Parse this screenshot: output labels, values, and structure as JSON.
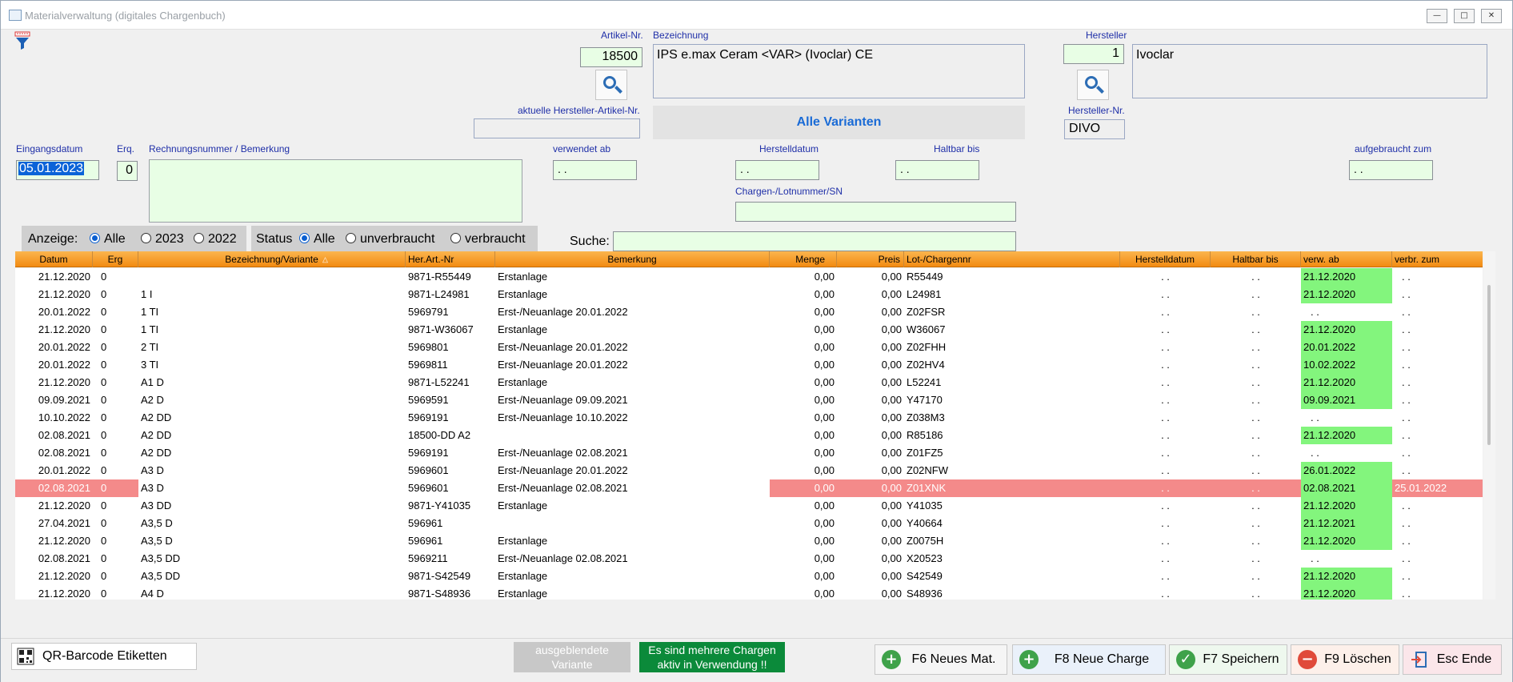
{
  "window": {
    "title": "Materialverwaltung  (digitales Chargenbuch)",
    "controls": {
      "minimize": "—",
      "maximize": "□",
      "close": "✕"
    }
  },
  "header": {
    "artikel_nr_label": "Artikel-Nr.",
    "artikel_nr_value": "18500",
    "bezeichnung_label": "Bezeichnung",
    "bezeichnung_value": "IPS e.max Ceram <VAR> (Ivoclar) CE",
    "hersteller_label": "Hersteller",
    "hersteller_value": "1",
    "hersteller_name_value": "Ivoclar",
    "akt_hersteller_artikel_label": "aktuelle Hersteller-Artikel-Nr.",
    "akt_hersteller_artikel_value": "",
    "variants_banner": "Alle Varianten",
    "hersteller_nr_label": "Hersteller-Nr.",
    "hersteller_nr_value": "DIVO"
  },
  "form": {
    "eingangsdatum_label": "Eingangsdatum",
    "eingangsdatum_value": "05.01.2023",
    "erq_label": "Erq.",
    "erq_value": "0",
    "rechnung_label": "Rechnungsnummer / Bemerkung",
    "rechnung_value": "",
    "verwendet_ab_label": "verwendet ab",
    "verwendet_ab_value": "  .  .",
    "herstelldatum_label": "Herstelldatum",
    "herstelldatum_value": "  .  .",
    "haltbar_bis_label": "Haltbar bis",
    "haltbar_bis_value": "  .  .",
    "aufgebraucht_label": "aufgebraucht zum",
    "aufgebraucht_value": "  .  .",
    "chargen_label": "Chargen-/Lotnummer/SN",
    "chargen_value": ""
  },
  "filter": {
    "anzeige_label": "Anzeige:",
    "anzeige_options": [
      "Alle",
      "2023",
      "2022"
    ],
    "anzeige_selected": "Alle",
    "status_label": "Status",
    "status_options": [
      "Alle",
      "unverbraucht",
      "verbraucht"
    ],
    "status_selected": "Alle",
    "suche_label": "Suche:",
    "suche_value": ""
  },
  "grid": {
    "columns": [
      "Datum",
      "Erg",
      "Bezeichnung/Variante",
      "Her.Art.-Nr",
      "Bemerkung",
      "Menge",
      "Preis",
      "Lot-/Chargennr",
      "Herstelldatum",
      "Haltbar bis",
      "verw. ab",
      "verbr. zum"
    ],
    "sort_indicator": "△",
    "rows": [
      [
        "21.12.2020",
        "0",
        "",
        "9871-R55449",
        "Erstanlage",
        "0,00",
        "0,00",
        "R55449",
        ". .",
        ". .",
        "21.12.2020",
        ". ."
      ],
      [
        "21.12.2020",
        "0",
        "1 I",
        "9871-L24981",
        "Erstanlage",
        "0,00",
        "0,00",
        "L24981",
        ". .",
        ". .",
        "21.12.2020",
        ". ."
      ],
      [
        "20.01.2022",
        "0",
        "1 TI",
        "5969791",
        "Erst-/Neuanlage 20.01.2022",
        "0,00",
        "0,00",
        "Z02FSR",
        ". .",
        ". .",
        ". .",
        ". ."
      ],
      [
        "21.12.2020",
        "0",
        "1 TI",
        "9871-W36067",
        "Erstanlage",
        "0,00",
        "0,00",
        "W36067",
        ". .",
        ". .",
        "21.12.2020",
        ". ."
      ],
      [
        "20.01.2022",
        "0",
        "2 TI",
        "5969801",
        "Erst-/Neuanlage 20.01.2022",
        "0,00",
        "0,00",
        "Z02FHH",
        ". .",
        ". .",
        "20.01.2022",
        ". ."
      ],
      [
        "20.01.2022",
        "0",
        "3 TI",
        "5969811",
        "Erst-/Neuanlage 20.01.2022",
        "0,00",
        "0,00",
        "Z02HV4",
        ". .",
        ". .",
        "10.02.2022",
        ". ."
      ],
      [
        "21.12.2020",
        "0",
        "A1 D",
        "9871-L52241",
        "Erstanlage",
        "0,00",
        "0,00",
        "L52241",
        ". .",
        ". .",
        "21.12.2020",
        ". ."
      ],
      [
        "09.09.2021",
        "0",
        "A2 D",
        "5969591",
        "Erst-/Neuanlage 09.09.2021",
        "0,00",
        "0,00",
        "Y47170",
        ". .",
        ". .",
        "09.09.2021",
        ". ."
      ],
      [
        "10.10.2022",
        "0",
        "A2 DD",
        "5969191",
        "Erst-/Neuanlage 10.10.2022",
        "0,00",
        "0,00",
        "Z038M3",
        ". .",
        ". .",
        ". .",
        ". ."
      ],
      [
        "02.08.2021",
        "0",
        "A2 DD",
        "18500-DD A2",
        "",
        "0,00",
        "0,00",
        "R85186",
        ". .",
        ". .",
        "21.12.2020",
        ". ."
      ],
      [
        "02.08.2021",
        "0",
        "A2 DD",
        "5969191",
        "Erst-/Neuanlage 02.08.2021",
        "0,00",
        "0,00",
        "Z01FZ5",
        ". .",
        ". .",
        ". .",
        ". ."
      ],
      [
        "20.01.2022",
        "0",
        "A3 D",
        "5969601",
        "Erst-/Neuanlage 20.01.2022",
        "0,00",
        "0,00",
        "Z02NFW",
        ". .",
        ". .",
        "26.01.2022",
        ". ."
      ],
      [
        "02.08.2021",
        "0",
        "A3 D",
        "5969601",
        "Erst-/Neuanlage 02.08.2021",
        "0,00",
        "0,00",
        "Z01XNK",
        ". .",
        ". .",
        "02.08.2021",
        "25.01.2022"
      ],
      [
        "21.12.2020",
        "0",
        "A3 DD",
        "9871-Y41035",
        "Erstanlage",
        "0,00",
        "0,00",
        "Y41035",
        ". .",
        ". .",
        "21.12.2020",
        ". ."
      ],
      [
        "27.04.2021",
        "0",
        "A3,5 D",
        "596961",
        "",
        "0,00",
        "0,00",
        "Y40664",
        ". .",
        ". .",
        "21.12.2021",
        ". ."
      ],
      [
        "21.12.2020",
        "0",
        "A3,5 D",
        "596961",
        "Erstanlage",
        "0,00",
        "0,00",
        "Z0075H",
        ". .",
        ". .",
        "21.12.2020",
        ". ."
      ],
      [
        "02.08.2021",
        "0",
        "A3,5 DD",
        "5969211",
        "Erst-/Neuanlage 02.08.2021",
        "0,00",
        "0,00",
        "X20523",
        ". .",
        ". .",
        ". .",
        ". ."
      ],
      [
        "21.12.2020",
        "0",
        "A3,5 DD",
        "9871-S42549",
        "Erstanlage",
        "0,00",
        "0,00",
        "S42549",
        ". .",
        ". .",
        "21.12.2020",
        ". ."
      ],
      [
        "21.12.2020",
        "0",
        "A4 D",
        "9871-S48936",
        "Erstanlage",
        "0,00",
        "0,00",
        "S48936",
        ". .",
        ". .",
        "21.12.2020",
        ". ."
      ]
    ],
    "highlighted_row": 12,
    "colors": {
      "highlight": "#f48a8a",
      "verw_green": "#83f57d",
      "header_orange": "#f7a23a"
    }
  },
  "footer": {
    "qr_button": "QR-Barcode Etiketten",
    "hidden_variant_line1": "ausgeblendete",
    "hidden_variant_line2": "Variante",
    "multi_charge_line1": "Es sind mehrere Chargen",
    "multi_charge_line2": "aktiv in Verwendung !!",
    "f6_label": "F6 Neues Mat.",
    "f8_label": "F8 Neue Charge",
    "f7_label": "F7 Speichern",
    "f9_label": "F9 Löschen",
    "esc_label": "Esc Ende"
  }
}
